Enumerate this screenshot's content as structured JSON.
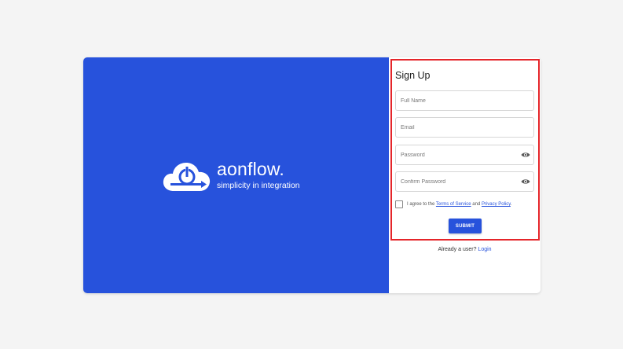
{
  "brand": {
    "name": "aonflow.",
    "tagline": "simplicity in integration",
    "panel_color": "#2752dc",
    "logo_icon": "cloud-power-icon"
  },
  "form": {
    "title": "Sign Up",
    "fields": [
      {
        "key": "full_name",
        "placeholder": "Full Name",
        "value": ""
      },
      {
        "key": "email",
        "placeholder": "Email",
        "value": ""
      },
      {
        "key": "password",
        "placeholder": "Password",
        "value": "",
        "icon": "eye-icon"
      },
      {
        "key": "confirm_password",
        "placeholder": "Confirm Password",
        "value": "",
        "icon": "eye-icon"
      }
    ],
    "agree": {
      "checked": false,
      "prefix": "I agree to the",
      "terms_label": "Terms of Service",
      "joiner": "and",
      "privacy_label": "Privacy Policy",
      "suffix": "."
    },
    "submit_label": "SUBMIT",
    "login_prompt": "Already a user?",
    "login_label": "Login"
  },
  "colors": {
    "accent": "#2752dc",
    "highlight": "#e5252a",
    "background": "#f4f4f4"
  }
}
